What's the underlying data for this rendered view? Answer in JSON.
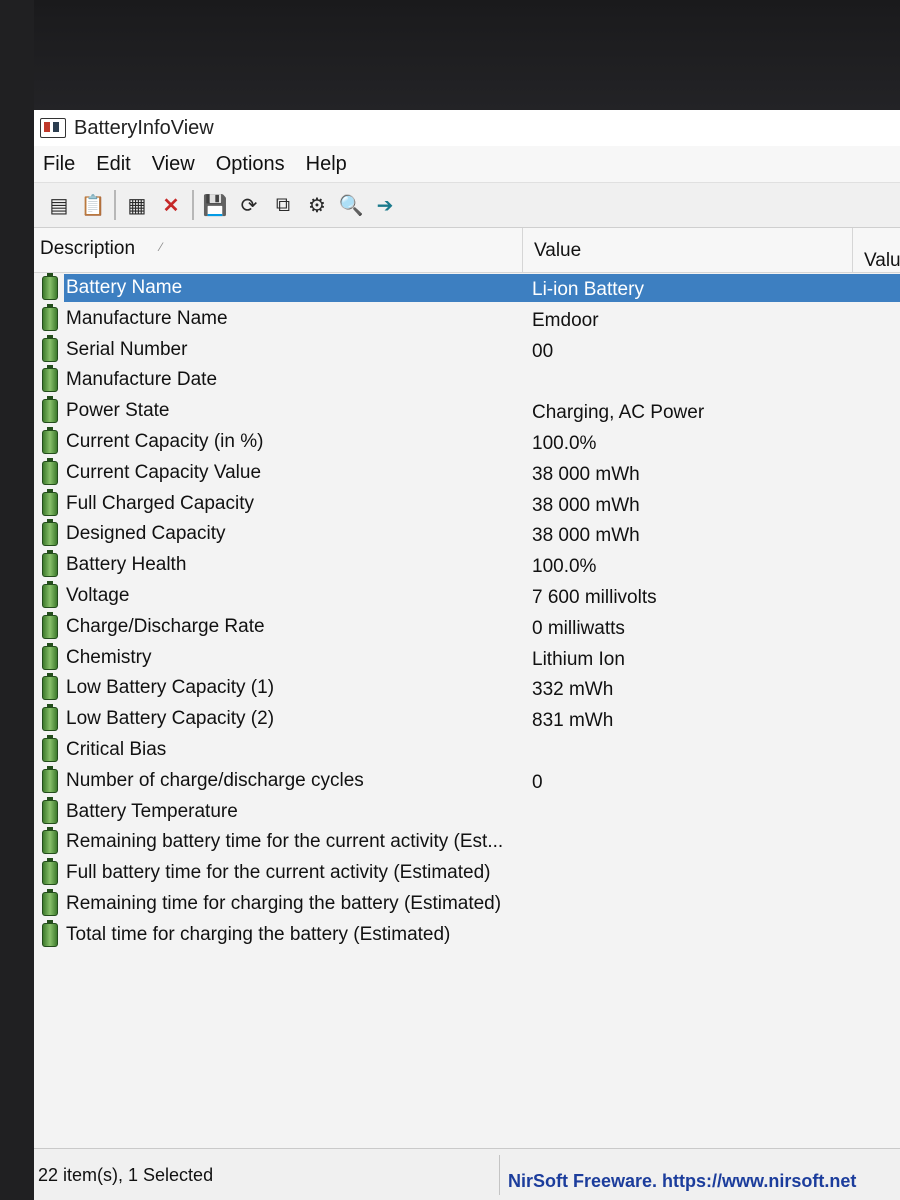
{
  "window": {
    "title": "BatteryInfoView"
  },
  "menu": [
    "File",
    "Edit",
    "View",
    "Options",
    "Help"
  ],
  "toolbar_icons": [
    "properties-icon",
    "html-report-icon",
    "columns-icon",
    "delete-icon",
    "save-icon",
    "refresh-icon",
    "copy-icon",
    "settings-icon",
    "find-icon",
    "exit-icon"
  ],
  "columns": {
    "description": "Description",
    "value": "Value",
    "value2": "Valu"
  },
  "rows": [
    {
      "desc": "Battery Name",
      "value": "Li-ion Battery"
    },
    {
      "desc": "Manufacture Name",
      "value": "Emdoor"
    },
    {
      "desc": "Serial Number",
      "value": "00"
    },
    {
      "desc": "Manufacture Date",
      "value": ""
    },
    {
      "desc": "Power State",
      "value": "Charging, AC Power"
    },
    {
      "desc": "Current Capacity (in %)",
      "value": "100.0%"
    },
    {
      "desc": "Current Capacity Value",
      "value": "38 000 mWh"
    },
    {
      "desc": "Full Charged Capacity",
      "value": "38 000 mWh"
    },
    {
      "desc": "Designed Capacity",
      "value": "38 000 mWh"
    },
    {
      "desc": "Battery Health",
      "value": "100.0%"
    },
    {
      "desc": "Voltage",
      "value": "7 600 millivolts"
    },
    {
      "desc": "Charge/Discharge Rate",
      "value": "0 milliwatts"
    },
    {
      "desc": "Chemistry",
      "value": "Lithium Ion"
    },
    {
      "desc": "Low Battery Capacity (1)",
      "value": "332 mWh"
    },
    {
      "desc": "Low Battery Capacity (2)",
      "value": "831 mWh"
    },
    {
      "desc": "Critical Bias",
      "value": ""
    },
    {
      "desc": "Number of charge/discharge cycles",
      "value": "0"
    },
    {
      "desc": "Battery Temperature",
      "value": ""
    },
    {
      "desc": "Remaining battery time for the current activity (Est...",
      "value": ""
    },
    {
      "desc": "Full battery time for the current activity (Estimated)",
      "value": ""
    },
    {
      "desc": "Remaining time for charging the battery (Estimated)",
      "value": ""
    },
    {
      "desc": "Total  time for charging the battery (Estimated)",
      "value": ""
    }
  ],
  "selected_row": "Battery Name",
  "status": {
    "items": "22 item(s), 1 Selected",
    "link": "NirSoft Freeware. https://www.nirsoft.net"
  }
}
